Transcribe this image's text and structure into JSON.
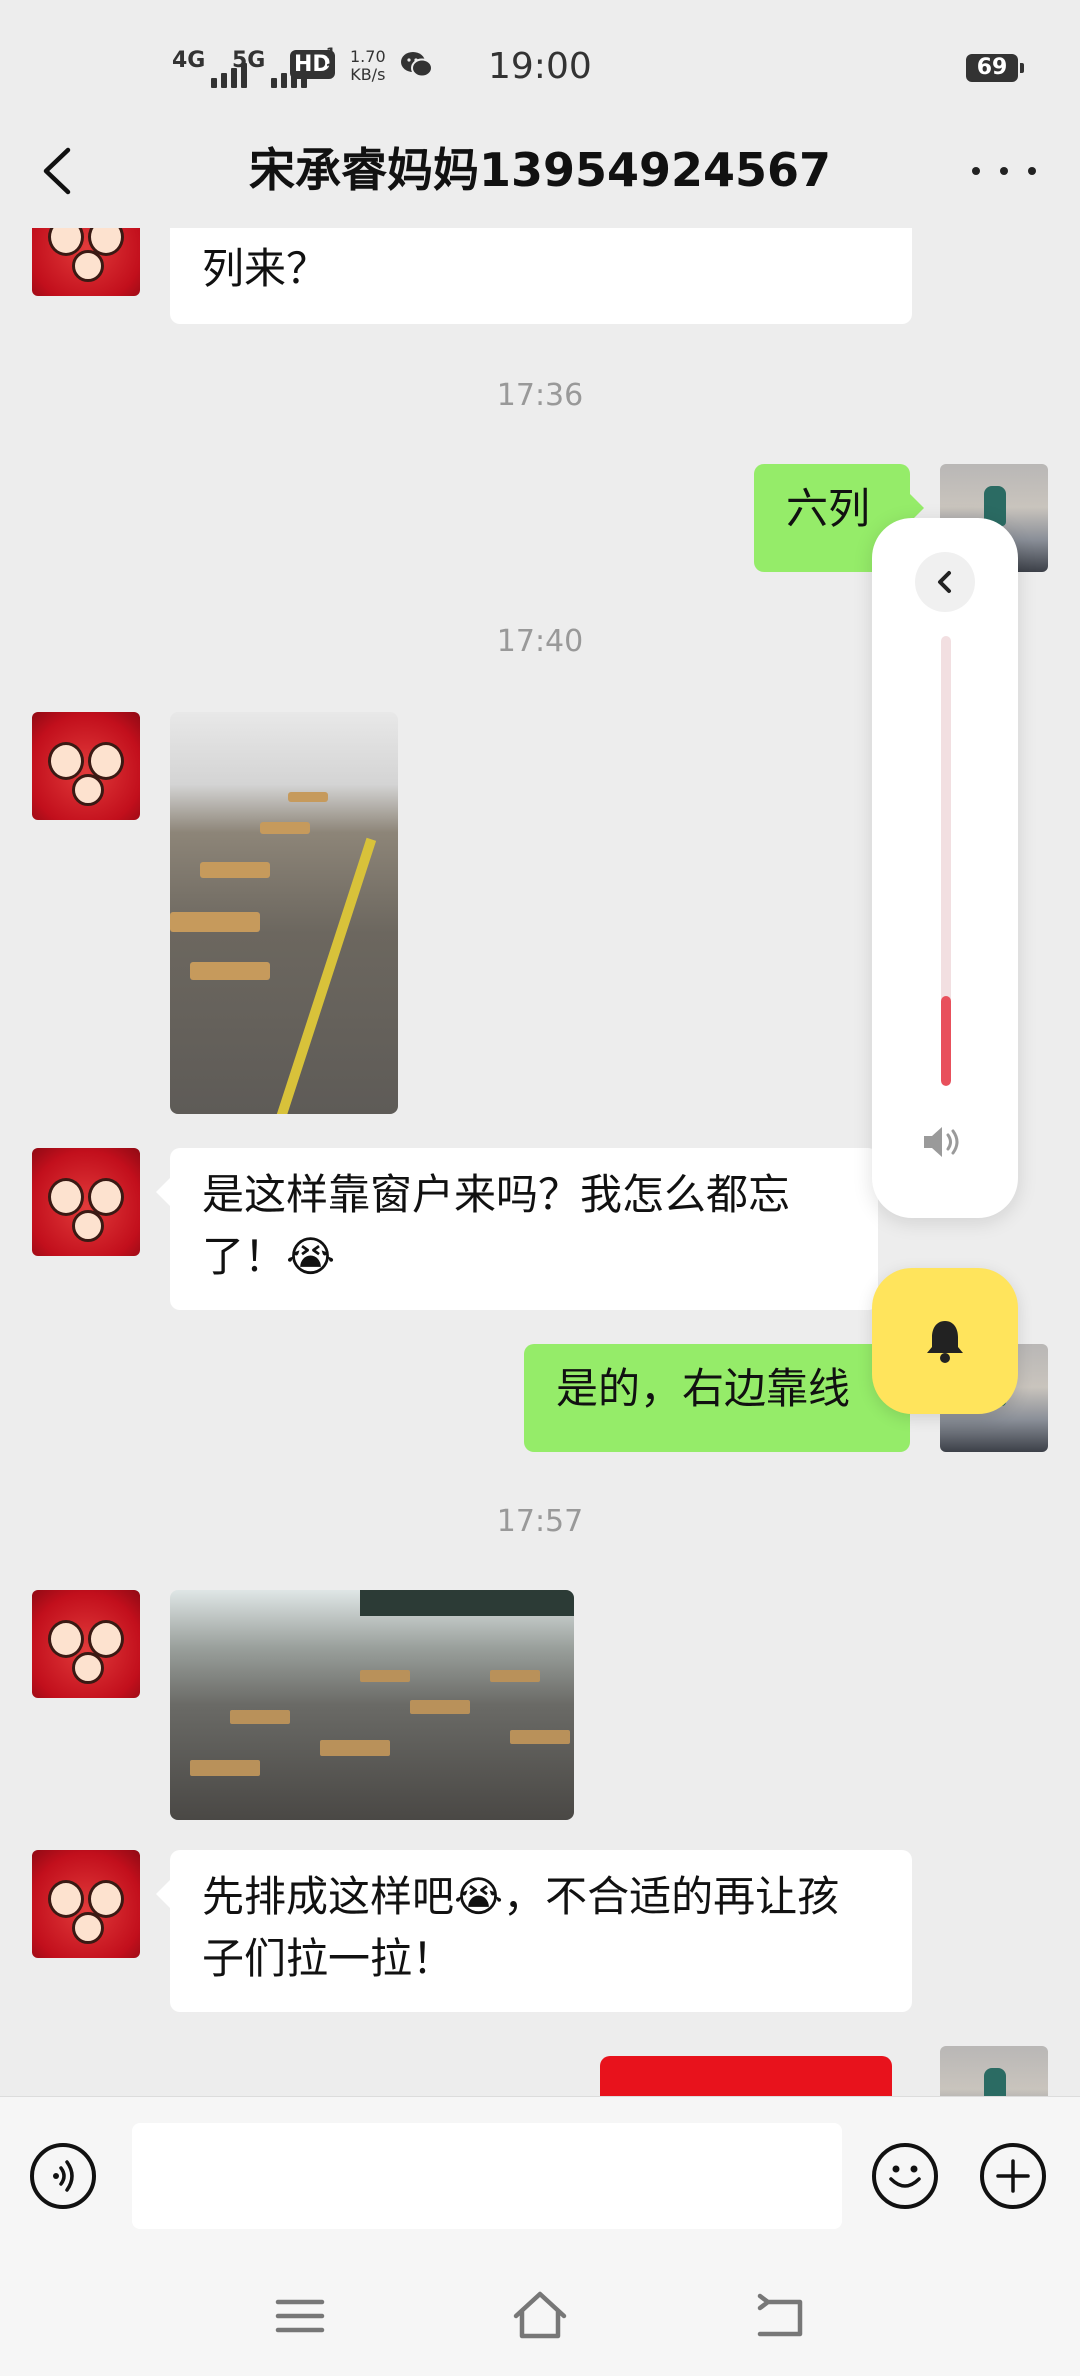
{
  "status_bar": {
    "sig1_label": "4G",
    "sig2_label": "5G",
    "hd_label": "HD",
    "hd_sub": "1\n2",
    "speed_value": "1.70",
    "speed_unit": "KB/s",
    "time": "19:00",
    "battery": "69"
  },
  "header": {
    "title": "宋承睿妈妈13954924567"
  },
  "messages": {
    "partial_text": "列来？",
    "ts1": "17:36",
    "reply1": "六列",
    "ts2": "17:40",
    "msg2": "是这样靠窗户来吗？我怎么都忘了！😭",
    "reply2": "是的，右边靠线",
    "ts3": "17:57",
    "msg3": "先排成这样吧😭，不合适的再让孩子们拉一拉！"
  },
  "volume_panel": {
    "level_percent": 20
  },
  "colors": {
    "own_bubble": "#95ec69",
    "other_bubble": "#ffffff",
    "volume_fill": "#e8505c",
    "bell_button": "#ffe45c"
  },
  "icons": {
    "back": "chevron-left-icon",
    "more": "more-dots-icon",
    "voice": "voice-input-icon",
    "emoji": "emoji-icon",
    "plus": "plus-icon",
    "bell": "bell-icon",
    "speaker": "speaker-icon"
  }
}
